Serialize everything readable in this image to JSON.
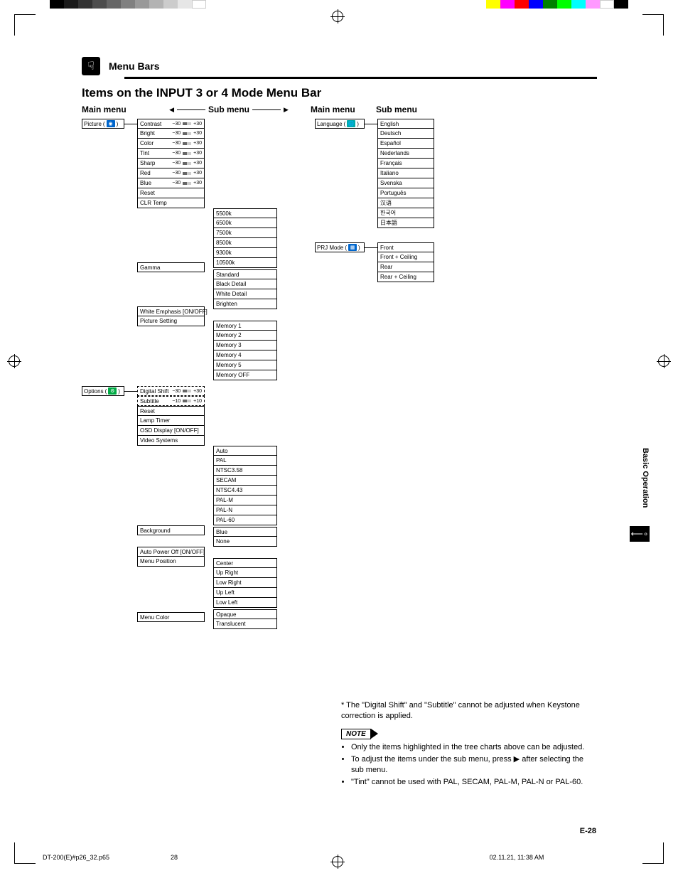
{
  "header": {
    "section": "Menu Bars",
    "title": "Items on the INPUT 3 or 4 Mode Menu Bar"
  },
  "col_labels": {
    "main": "Main menu",
    "sub": "Sub menu"
  },
  "picture": {
    "label": "Picture",
    "items": [
      {
        "name": "Contrast",
        "min": "−30",
        "max": "+30"
      },
      {
        "name": "Bright",
        "min": "−30",
        "max": "+30"
      },
      {
        "name": "Color",
        "min": "−30",
        "max": "+30"
      },
      {
        "name": "Tint",
        "min": "−30",
        "max": "+30"
      },
      {
        "name": "Sharp",
        "min": "−30",
        "max": "+30"
      },
      {
        "name": "Red",
        "min": "−30",
        "max": "+30"
      },
      {
        "name": "Blue",
        "min": "−30",
        "max": "+30"
      }
    ],
    "reset": "Reset",
    "clr_temp": {
      "label": "CLR Temp",
      "options": [
        "5500k",
        "6500k",
        "7500k",
        "8500k",
        "9300k",
        "10500k"
      ]
    },
    "gamma": {
      "label": "Gamma",
      "options": [
        "Standard",
        "Black Detail",
        "White Detail",
        "Brighten"
      ]
    },
    "white_emphasis": "White Emphasis   [ON/OFF]",
    "picture_setting": {
      "label": "Picture Setting",
      "options": [
        "Memory 1",
        "Memory 2",
        "Memory 3",
        "Memory 4",
        "Memory 5",
        "Memory OFF"
      ]
    }
  },
  "options": {
    "label": "Options",
    "dash_items": [
      {
        "name": "Digital Shift",
        "min": "−30",
        "max": "+30"
      },
      {
        "name": "Subtitle",
        "min": "−10",
        "max": "+10"
      }
    ],
    "items": [
      "Reset",
      "Lamp Timer"
    ],
    "osd": "OSD Display   [ON/OFF]",
    "video_systems": {
      "label": "Video Systems",
      "options": [
        "Auto",
        "PAL",
        "NTSC3.58",
        "SECAM",
        "NTSC4.43",
        "PAL-M",
        "PAL-N",
        "PAL-60"
      ]
    },
    "background": {
      "label": "Background",
      "options": [
        "Blue",
        "None"
      ]
    },
    "auto_power": "Auto Power Off  [ON/OFF]",
    "menu_position": {
      "label": "Menu Position",
      "options": [
        "Center",
        "Up Right",
        "Low Right",
        "Up Left",
        "Low Left"
      ]
    },
    "menu_color": {
      "label": "Menu Color",
      "options": [
        "Opaque",
        "Translucent"
      ]
    }
  },
  "language": {
    "label": "Language",
    "options": [
      "English",
      "Deutsch",
      "Español",
      "Nederlands",
      "Français",
      "Italiano",
      "Svenska",
      "Português",
      "汉语",
      "한국어",
      "日本語"
    ]
  },
  "prj_mode": {
    "label": "PRJ Mode",
    "options": [
      "Front",
      "Front + Ceiling",
      "Rear",
      "Rear + Ceiling"
    ]
  },
  "side_tab": "Basic Operation",
  "footnote": "* The \"Digital Shift\" and \"Subtitle\" cannot be adjusted when Keystone correction is applied.",
  "note_label": "NOTE",
  "notes": [
    "Only the items highlighted in the tree charts above can be adjusted.",
    "To adjust the items under the sub menu, press ▶ after selecting the sub menu.",
    "\"Tint\" cannot be used with PAL, SECAM, PAL-M, PAL-N or PAL-60."
  ],
  "page_number": "E-28",
  "footer": {
    "file": "DT-200(E)#p26_32.p65",
    "page": "28",
    "timestamp": "02.11.21, 11:38 AM"
  }
}
